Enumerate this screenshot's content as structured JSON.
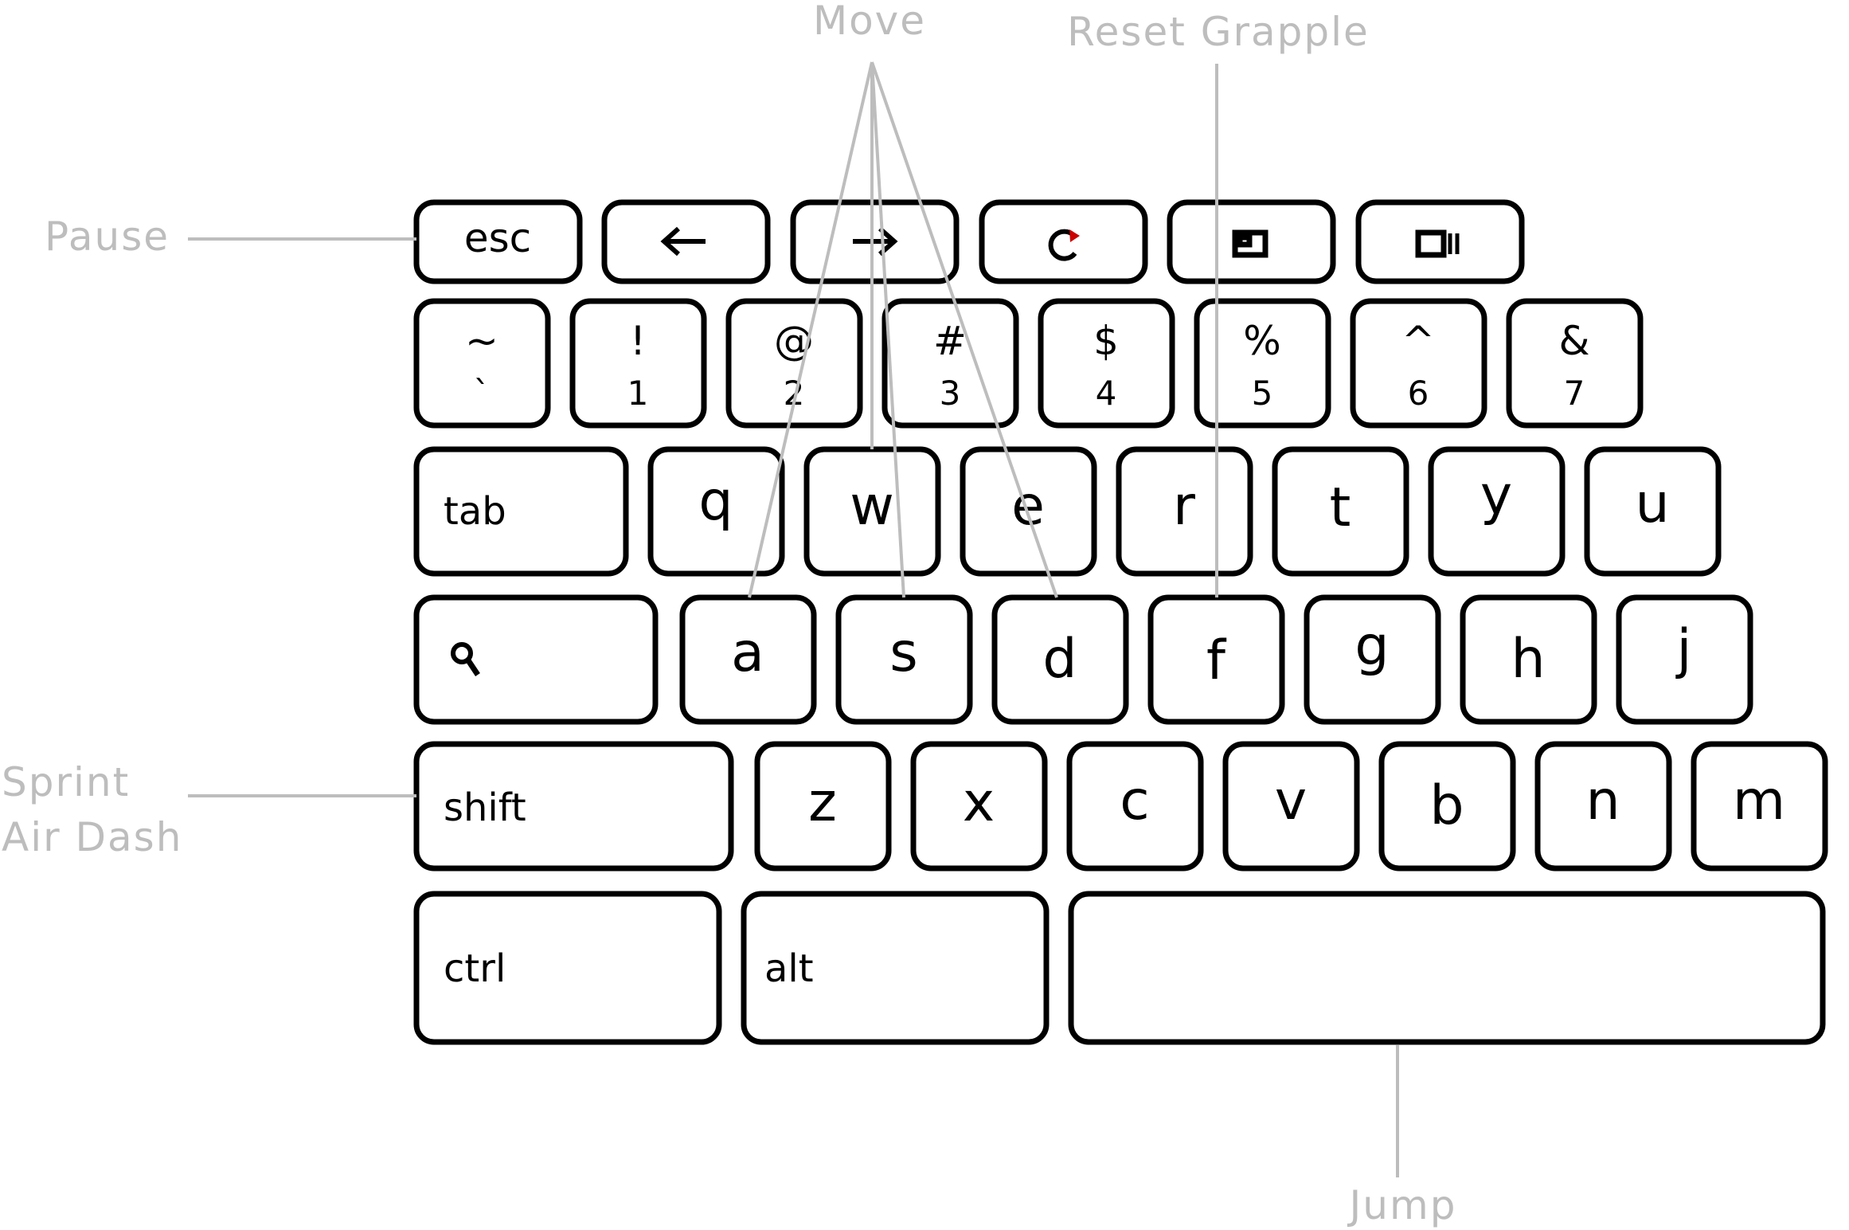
{
  "keyboard": {
    "fn_row": [
      "esc",
      "",
      "",
      "",
      "",
      ""
    ],
    "fn_icons": [
      "",
      "back-arrow-icon",
      "forward-arrow-icon",
      "reload-icon",
      "fullscreen-icon",
      "overview-icon"
    ],
    "number_row": [
      {
        "top": "~",
        "bottom": "`"
      },
      {
        "top": "!",
        "bottom": "1"
      },
      {
        "top": "@",
        "bottom": "2"
      },
      {
        "top": "#",
        "bottom": "3"
      },
      {
        "top": "$",
        "bottom": "4"
      },
      {
        "top": "%",
        "bottom": "5"
      },
      {
        "top": "^",
        "bottom": "6"
      },
      {
        "top": "&",
        "bottom": "7"
      }
    ],
    "row_q": [
      "tab",
      "q",
      "w",
      "e",
      "r",
      "t",
      "y",
      "u"
    ],
    "row_a": [
      "",
      "a",
      "s",
      "d",
      "f",
      "g",
      "h",
      "j"
    ],
    "row_a_icon": "search-icon",
    "row_z": [
      "shift",
      "z",
      "x",
      "c",
      "v",
      "b",
      "n",
      "m"
    ],
    "bottom_row": [
      "ctrl",
      "alt",
      ""
    ]
  },
  "annotations": {
    "move": "Move",
    "reset_grapple": "Reset Grapple",
    "pause": "Pause",
    "sprint": "Sprint",
    "air_dash": "Air Dash",
    "jump": "Jump"
  },
  "colors": {
    "key_border": "#000000",
    "annotation": "#bdbdbd"
  }
}
